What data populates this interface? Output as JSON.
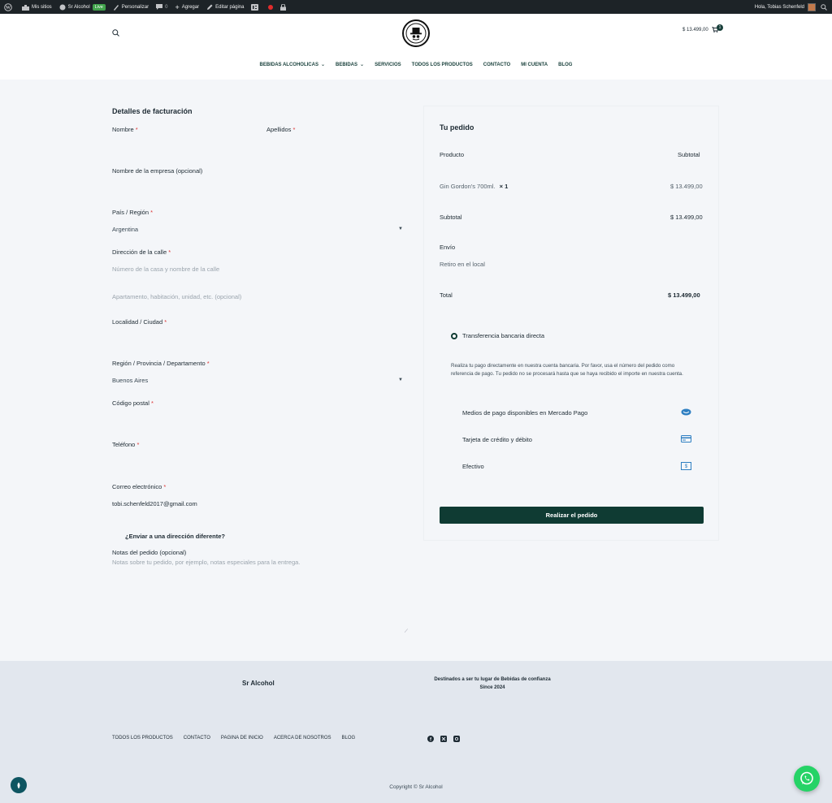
{
  "adminbar": {
    "my_sites": "Mis sitios",
    "site_name": "Sr Alcohol",
    "live_badge": "Live",
    "customize": "Personalizar",
    "comments_count": "0",
    "new": "Agregar",
    "edit_page": "Editar página",
    "greeting": "Hola, Tobias Schenfeld"
  },
  "header": {
    "cart_total": "$ 13.499,00",
    "cart_count": "1",
    "nav": [
      {
        "label": "BEBIDAS ALCOHOLICAS",
        "has_dropdown": true
      },
      {
        "label": "BEBIDAS",
        "has_dropdown": true
      },
      {
        "label": "SERVICIOS",
        "has_dropdown": false
      },
      {
        "label": "TODOS LOS PRODUCTOS",
        "has_dropdown": false
      },
      {
        "label": "CONTACTO",
        "has_dropdown": false
      },
      {
        "label": "MI CUENTA",
        "has_dropdown": false
      },
      {
        "label": "BLOG",
        "has_dropdown": false
      }
    ]
  },
  "billing": {
    "title": "Detalles de facturación",
    "first_name_label": "Nombre",
    "last_name_label": "Apellidos",
    "company_label": "Nombre de la empresa (opcional)",
    "country_label": "País / Región",
    "country_value": "Argentina",
    "street_label": "Dirección de la calle",
    "street_placeholder": "Número de la casa y nombre de la calle",
    "street2_placeholder": "Apartamento, habitación, unidad, etc. (opcional)",
    "city_label": "Localidad / Ciudad",
    "state_label": "Región / Provincia / Departamento",
    "state_value": "Buenos Aires",
    "postcode_label": "Código postal",
    "phone_label": "Teléfono",
    "email_label": "Correo electrónico",
    "email_value": "tobi.schenfeld2017@gmail.com",
    "ship_different": "¿Enviar a una dirección diferente?",
    "notes_label": "Notas del pedido (opcional)",
    "notes_placeholder": "Notas sobre tu pedido, por ejemplo, notas especiales para la entrega.",
    "required_mark": "*"
  },
  "order": {
    "title": "Tu pedido",
    "col_product": "Producto",
    "col_subtotal": "Subtotal",
    "item_name": "Gin Gordon's 700ml.",
    "item_qty": "× 1",
    "item_price": "$ 13.499,00",
    "subtotal_label": "Subtotal",
    "subtotal_value": "$ 13.499,00",
    "shipping_label": "Envío",
    "shipping_value": "Retiro en el local",
    "total_label": "Total",
    "total_value": "$ 13.499,00",
    "payment_method": "Transferencia bancaria directa",
    "payment_desc": "Realiza tu pago directamente en nuestra cuenta bancaria. Por favor, usa el número del pedido como referencia de pago. Tu pedido no se procesará hasta que se haya recibido el importe en nuestra cuenta.",
    "payment_options": [
      {
        "label": "Medios de pago disponibles en Mercado Pago",
        "icon": "mercadopago-icon"
      },
      {
        "label": "Tarjeta de crédito y débito",
        "icon": "credit-card-icon"
      },
      {
        "label": "Efectivo",
        "icon": "cash-icon"
      }
    ],
    "place_order": "Realizar el pedido"
  },
  "footer": {
    "brand": "Sr Alcohol",
    "tagline": "Destinados a ser tu lugar de Bebidas de confianza",
    "since": "Since 2024",
    "links": [
      "TODOS LOS PRODUCTOS",
      "CONTACTO",
      "PAGINA DE INICIO",
      "ACERCA DE NOSOTROS",
      "BLOG"
    ],
    "copyright": "Copyright © Sr Alcohol"
  },
  "colors": {
    "brand": "#0f3b33",
    "whatsapp": "#25d366",
    "accent": "#2e7fc2"
  }
}
